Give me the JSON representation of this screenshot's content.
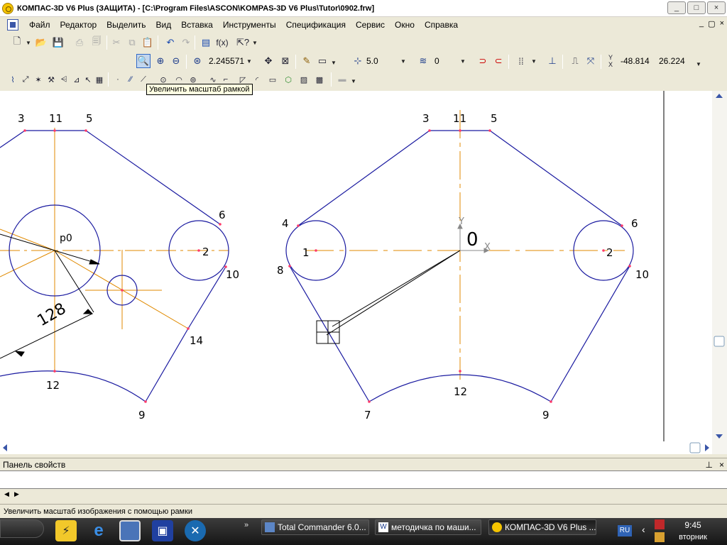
{
  "window": {
    "title": "КОМПАС-3D V6 Plus (ЗАЩИТА) - [C:\\Program Files\\ASCON\\KOMPAS-3D V6 Plus\\Tutor\\0902.frw]",
    "buttons": [
      "_",
      "□",
      "×"
    ]
  },
  "menu": {
    "items": [
      "Файл",
      "Редактор",
      "Выделить",
      "Вид",
      "Вставка",
      "Инструменты",
      "Спецификация",
      "Сервис",
      "Окно",
      "Справка"
    ],
    "mdi_buttons": [
      "_",
      "▢",
      "×"
    ]
  },
  "toolbar": {
    "zoom_value": "2.245571",
    "step_value": "5.0",
    "layer_value": "0",
    "coord_x": "-48.814",
    "coord_y": "26.224",
    "func_label": "f(x)",
    "tooltip": "Увеличить масштаб рамкой"
  },
  "drawing": {
    "left_labels": [
      "3",
      "11",
      "5",
      "6",
      "2",
      "10",
      "14",
      "12",
      "9"
    ],
    "right_labels": [
      "3",
      "11",
      "5",
      "4",
      "6",
      "1",
      "2",
      "8",
      "10",
      "12",
      "7",
      "9"
    ],
    "p0_label": "p0",
    "dimension": "128",
    "origin_label": "0",
    "axis_x": "X",
    "axis_y": "Y"
  },
  "panels": {
    "properties_title": "Панель свойств",
    "status_text": "Увеличить масштаб изображения с помощью рамки"
  },
  "taskbar": {
    "tasks": [
      "Total Commander 6.0...",
      "методичка по маши...",
      "КОМПАС-3D V6 Plus ..."
    ],
    "lang": "RU",
    "time": "9:45",
    "day": "вторник"
  },
  "colors": {
    "contour": "#1a1aa0",
    "axis": "#e08a00",
    "point": "#ff3a6a",
    "background": "#ece9d8"
  }
}
